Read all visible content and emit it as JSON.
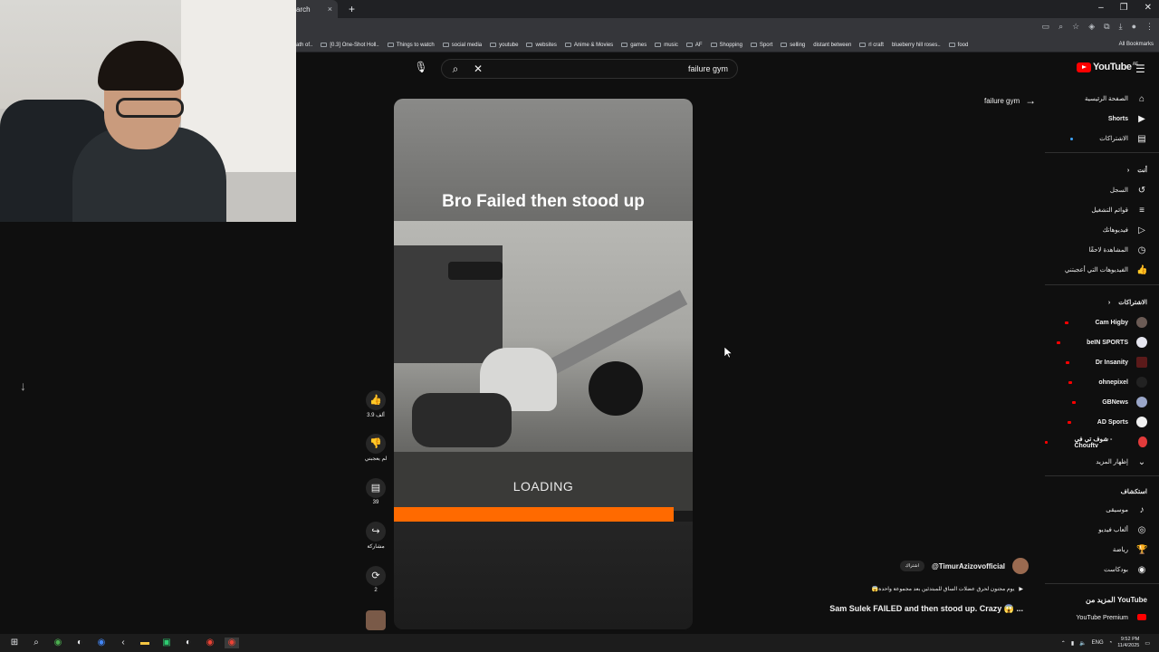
{
  "browser": {
    "tab_title": "arch",
    "close_glyph": "×",
    "newtab_glyph": "+",
    "window_controls": [
      "–",
      "❐",
      "✕"
    ],
    "bookmarks": [
      "ath of..",
      "[0.3] One-Shot Holl..",
      "Things to watch",
      "social media",
      "youtube",
      "websites",
      "Anime & Movies",
      "games",
      "music",
      "AF",
      "Shopping",
      "Sport",
      "selling",
      "distant between",
      "rl craft",
      "blueberry hill roses..",
      "food"
    ],
    "all_bookmarks": "All Bookmarks"
  },
  "search": {
    "query": "failure gym",
    "mic_icon": "microphone-icon",
    "search_icon": "search-icon",
    "clear_icon": "close-icon"
  },
  "logo": {
    "text": "YouTube",
    "region": "AE"
  },
  "suggestion": {
    "text": "failure gym"
  },
  "sidebar": {
    "main": [
      {
        "label": "الصفحة الرئيسية",
        "icon": "home-icon",
        "glyph": "⌂"
      },
      {
        "label": "Shorts",
        "icon": "shorts-icon",
        "glyph": "▶"
      },
      {
        "label": "الاشتراكات",
        "icon": "subscriptions-icon",
        "glyph": "▤"
      }
    ],
    "you_header": "أنت",
    "you": [
      {
        "label": "السجل",
        "icon": "history-icon",
        "glyph": "↺"
      },
      {
        "label": "قوائم التشغيل",
        "icon": "playlists-icon",
        "glyph": "≡"
      },
      {
        "label": "فيديوهاتك",
        "icon": "your-videos-icon",
        "glyph": "▷"
      },
      {
        "label": "المشاهدة لاحقًا",
        "icon": "watch-later-icon",
        "glyph": "◷"
      },
      {
        "label": "الفيديوهات التي أعجبتني",
        "icon": "liked-icon",
        "glyph": "👍"
      }
    ],
    "subs_header": "الاشتراكات",
    "subscriptions": [
      "Cam Higby",
      "beIN SPORTS",
      "Dr Insanity",
      "ohnepixel",
      "GBNews",
      "AD Sports",
      "شوف تي في - Chouftv"
    ],
    "show_more": "إظهار المزيد",
    "explore_header": "استكشاف",
    "explore": [
      {
        "label": "موسيقى",
        "icon": "music-icon",
        "glyph": "♪"
      },
      {
        "label": "ألعاب فيديو",
        "icon": "gaming-icon",
        "glyph": "◎"
      },
      {
        "label": "رياضة",
        "icon": "trophy-icon",
        "glyph": "🏆"
      },
      {
        "label": "بودكاست",
        "icon": "podcast-icon",
        "glyph": "◉"
      }
    ],
    "more_header": "المزيد من YouTube",
    "more": [
      {
        "label": "YouTube Premium",
        "icon": "youtube-premium-icon"
      }
    ]
  },
  "player": {
    "overlay_title": "Bro Failed then stood up",
    "loading_text": "LOADING",
    "progress": 0.935
  },
  "actions": {
    "like_count": "3.9 ألف",
    "dislike_label": "لم يعجبني",
    "comment_count": "39",
    "share_label": "مشاركة",
    "remix_count": "2"
  },
  "video": {
    "channel": "@TimurAzizovofficial",
    "subscribe_label": "اشتراك",
    "description": "😱يوم مجنون لحرق عضلات الساق للمبتدئين بعد مجموعة واحدة",
    "title": "Sam Sulek FAILED and then stood up. Crazy 😱 ..."
  },
  "taskbar": {
    "lang": "ENG",
    "time": "9:52 PM",
    "date": "11/4/2025"
  },
  "colors": {
    "accent": "#ff0000",
    "progress": "#ff6a00",
    "bg": "#0f0f0f"
  }
}
